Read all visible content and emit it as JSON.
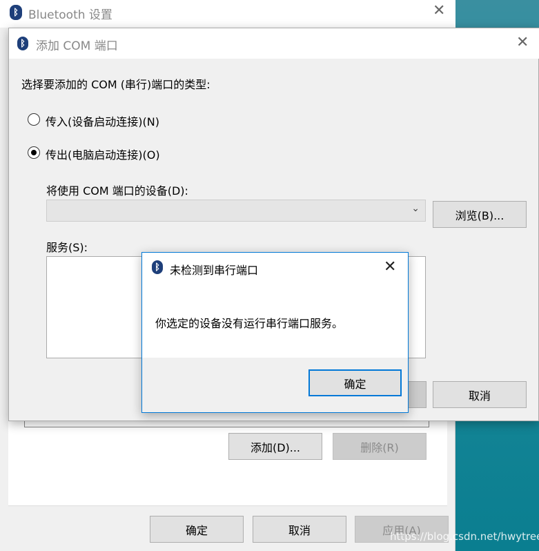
{
  "bt_window": {
    "title": "Bluetooth 设置",
    "add_label": "添加(D)...",
    "remove_label": "删除(R)",
    "ok_label": "确定",
    "cancel_label": "取消",
    "apply_label": "应用(A)"
  },
  "com_dialog": {
    "title": "添加 COM 端口",
    "prompt": "选择要添加的 COM (串行)端口的类型:",
    "incoming_label": "传入(设备启动连接)(N)",
    "outgoing_label": "传出(电脑启动连接)(O)",
    "selected": "outgoing",
    "device_label": "将使用 COM 端口的设备(D):",
    "device_value": "",
    "browse_label": "浏览(B)...",
    "services_label": "服务(S):",
    "cancel_label": "取消"
  },
  "message_box": {
    "title": "未检测到串行端口",
    "message": "你选定的设备没有运行串行端口服务。",
    "ok_label": "确定"
  },
  "watermark": "https://blog.csdn.net/hwytree",
  "colors": {
    "accent": "#0078d7",
    "bluetooth": "#1e3f7a"
  }
}
